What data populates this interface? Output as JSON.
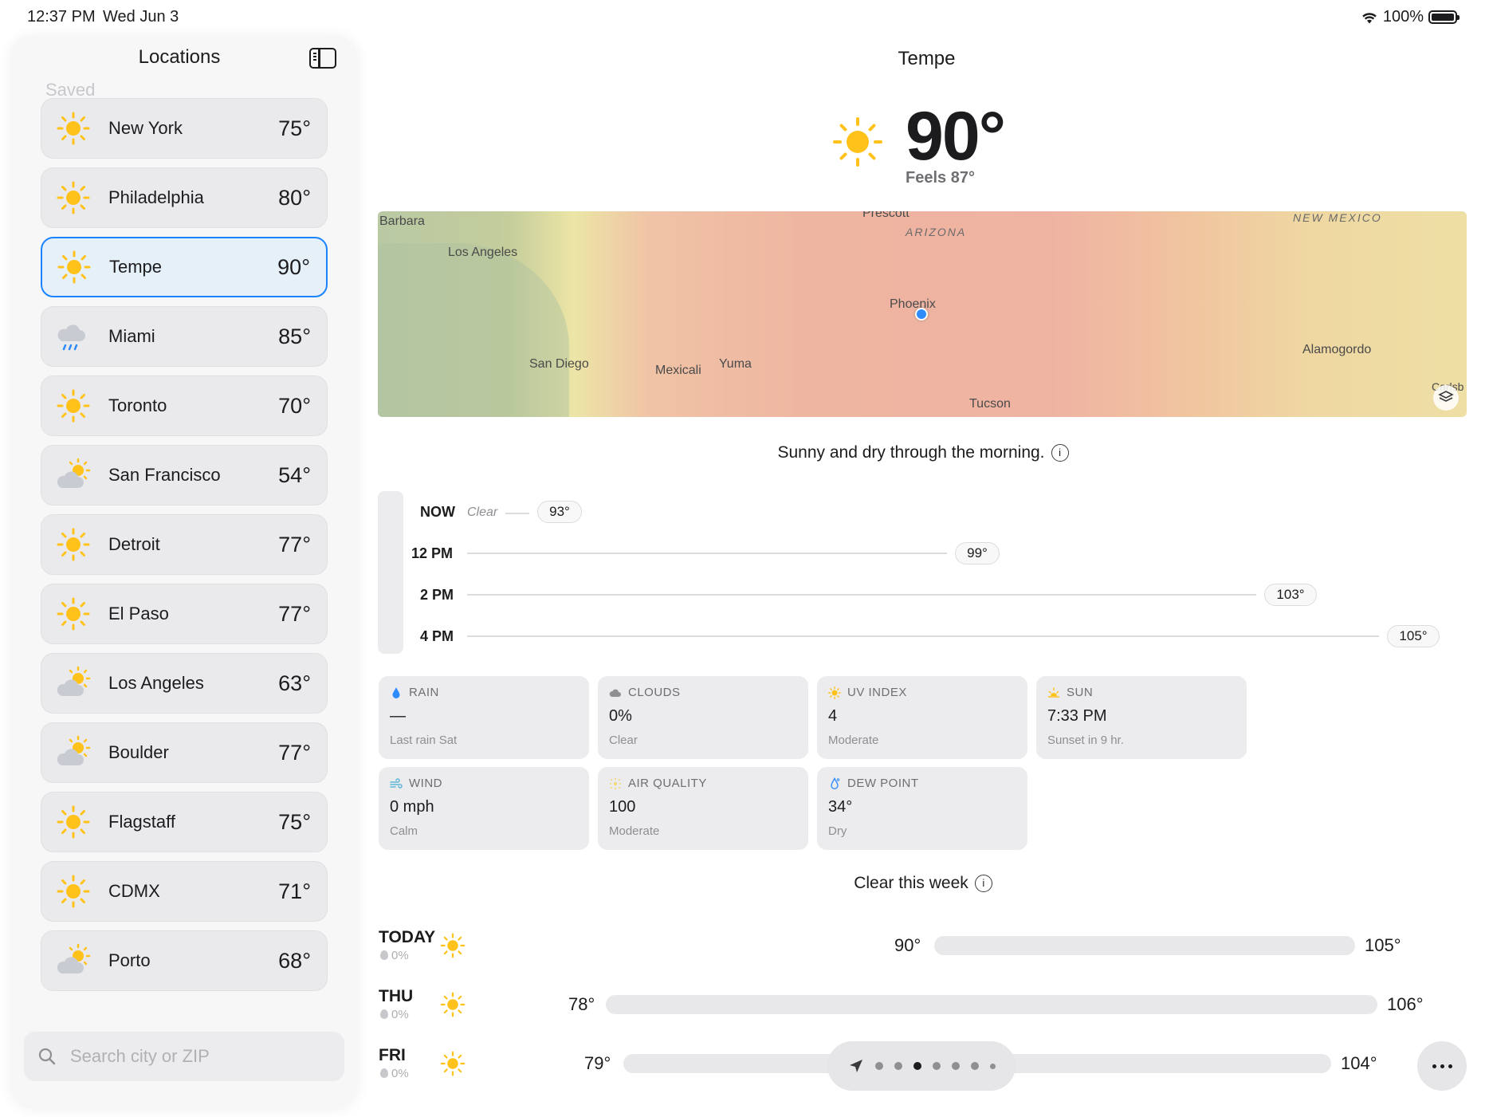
{
  "status": {
    "time": "12:37 PM",
    "date": "Wed Jun 3",
    "battery": "100%"
  },
  "sidebar": {
    "title": "Locations",
    "section": "Saved",
    "locations": [
      {
        "name": "New York",
        "temp": "75°",
        "icon": "sun-icon"
      },
      {
        "name": "Philadelphia",
        "temp": "80°",
        "icon": "sun-icon"
      },
      {
        "name": "Tempe",
        "temp": "90°",
        "icon": "sun-icon",
        "selected": true
      },
      {
        "name": "Miami",
        "temp": "85°",
        "icon": "rain-cloud-icon"
      },
      {
        "name": "Toronto",
        "temp": "70°",
        "icon": "sun-icon"
      },
      {
        "name": "San Francisco",
        "temp": "54°",
        "icon": "partly-cloudy-icon"
      },
      {
        "name": "Detroit",
        "temp": "77°",
        "icon": "sun-icon"
      },
      {
        "name": "El Paso",
        "temp": "77°",
        "icon": "sun-icon"
      },
      {
        "name": "Los Angeles",
        "temp": "63°",
        "icon": "partly-cloudy-icon"
      },
      {
        "name": "Boulder",
        "temp": "77°",
        "icon": "partly-cloudy-icon"
      },
      {
        "name": "Flagstaff",
        "temp": "75°",
        "icon": "sun-icon"
      },
      {
        "name": "CDMX",
        "temp": "71°",
        "icon": "sun-icon"
      },
      {
        "name": "Porto",
        "temp": "68°",
        "icon": "partly-cloudy-icon"
      }
    ],
    "search_placeholder": "Search city or ZIP"
  },
  "main": {
    "city": "Tempe",
    "temp": "90°",
    "feels": "Feels 87°",
    "map_labels": {
      "barbara": "Barbara",
      "prescott": "Prescott",
      "arizona": "ARIZONA",
      "new_mexico": "NEW MEXICO",
      "los_angeles": "Los Angeles",
      "phoenix": "Phoenix",
      "san_diego": "San Diego",
      "mexicali": "Mexicali",
      "yuma": "Yuma",
      "alamogordo": "Alamogordo",
      "tucson": "Tucson",
      "carlsbad": "Carlsb"
    },
    "summary": "Sunny and dry through the morning.",
    "hourly": [
      {
        "label": "NOW",
        "note": "Clear",
        "temp": "93°"
      },
      {
        "label": "12 PM",
        "temp": "99°"
      },
      {
        "label": "2 PM",
        "temp": "103°"
      },
      {
        "label": "4 PM",
        "temp": "105°"
      }
    ],
    "cards": {
      "rain": {
        "title": "RAIN",
        "value": "—",
        "sub": "Last rain Sat"
      },
      "clouds": {
        "title": "CLOUDS",
        "value": "0%",
        "sub": "Clear"
      },
      "uv": {
        "title": "UV INDEX",
        "value": "4",
        "sub": "Moderate"
      },
      "sun": {
        "title": "SUN",
        "value": "7:33 PM",
        "sub": "Sunset in 9 hr."
      },
      "wind": {
        "title": "WIND",
        "value": "0 mph",
        "sub": "Calm"
      },
      "air": {
        "title": "AIR QUALITY",
        "value": "100",
        "sub": "Moderate"
      },
      "dew": {
        "title": "DEW POINT",
        "value": "34°",
        "sub": "Dry"
      }
    },
    "week_title": "Clear this week",
    "daily": [
      {
        "day": "TODAY",
        "precip": "0%",
        "lo": "90°",
        "hi": "105°"
      },
      {
        "day": "THU",
        "precip": "0%",
        "lo": "78°",
        "hi": "106°"
      },
      {
        "day": "FRI",
        "precip": "0%",
        "lo": "79°",
        "hi": "104°"
      }
    ]
  }
}
